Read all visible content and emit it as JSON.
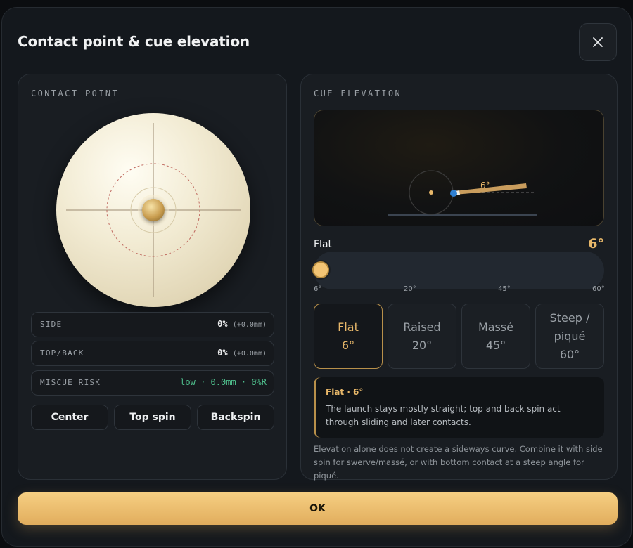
{
  "dialog": {
    "title": "Contact point & cue elevation",
    "close_icon": "close-icon"
  },
  "contact": {
    "label": "CONTACT POINT",
    "readouts": [
      {
        "label": "SIDE",
        "value": "0%",
        "sub": "(+0.0mm)"
      },
      {
        "label": "TOP/BACK",
        "value": "0%",
        "sub": "(+0.0mm)"
      },
      {
        "label": "MISCUE RISK",
        "risk": "low · 0.0mm · 0%R"
      }
    ],
    "buttons": [
      "Center",
      "Top spin",
      "Backspin"
    ]
  },
  "elevation": {
    "label": "CUE ELEVATION",
    "diagram_angle": "6°",
    "slider": {
      "name": "Flat",
      "value": "6°",
      "ticks": [
        "6°",
        "20°",
        "45°",
        "60°"
      ],
      "fraction": 0
    },
    "presets": [
      {
        "name": "Flat",
        "value": "6°",
        "active": true
      },
      {
        "name": "Raised",
        "value": "20°",
        "active": false
      },
      {
        "name": "Massé",
        "value": "45°",
        "active": false
      },
      {
        "name": "Steep /\npiqué",
        "value": "60°",
        "active": false
      }
    ],
    "note": {
      "title": "Flat · 6°",
      "body": "The launch stays mostly straight; top and back spin act through sliding and later contacts."
    },
    "footnote": "Elevation alone does not create a sideways curve. Combine it with side spin for swerve/massé, or with bottom contact at a steep angle for piqué."
  },
  "ok_label": "OK",
  "colors": {
    "accent": "#e8b86a",
    "risk_low": "#4fc08d",
    "cue_tip": "#2f7fd1"
  }
}
